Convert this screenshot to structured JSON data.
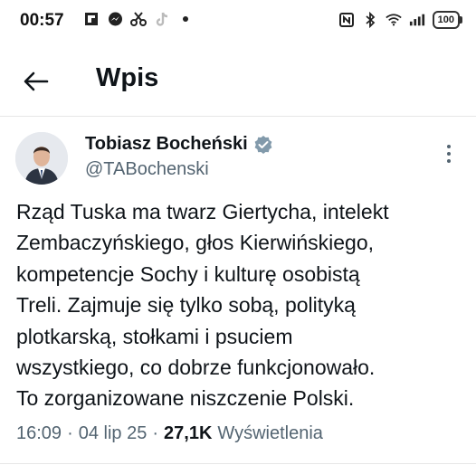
{
  "status_bar": {
    "time": "00:57",
    "battery": "100",
    "left_icons": [
      "flipboard-icon",
      "messenger-icon",
      "scissors-app-icon",
      "tiktok-icon",
      "dot-icon"
    ],
    "right_icons": [
      "nfc-icon",
      "bluetooth-icon",
      "wifi-icon",
      "signal-icon"
    ]
  },
  "header": {
    "title": "Wpis",
    "back_icon": "arrow-left-icon"
  },
  "post": {
    "author_name": "Tobiasz Bocheński",
    "author_handle": "@TABochenski",
    "verified": true,
    "text": "Rząd Tuska ma twarz Giertycha, intelekt\nZembaczyńskiego, głos Kierwińskiego,\nkompetencje Sochy i kulturę osobistą\nTreli. Zajmuje się tylko sobą, polityką\nplotkarską, stołkami i psuciem\nwszystkiego, co dobrze funkcjonowało.\nTo zorganizowane niszczenie Polski.",
    "time": "16:09",
    "separator": "·",
    "date": "04 lip 25",
    "views_count": "27,1K",
    "views_label": "Wyświetlenia"
  },
  "colors": {
    "text": "#0f1419",
    "secondary": "#536471",
    "verified_badge": "#829aab",
    "divider": "#e6e6e6"
  }
}
